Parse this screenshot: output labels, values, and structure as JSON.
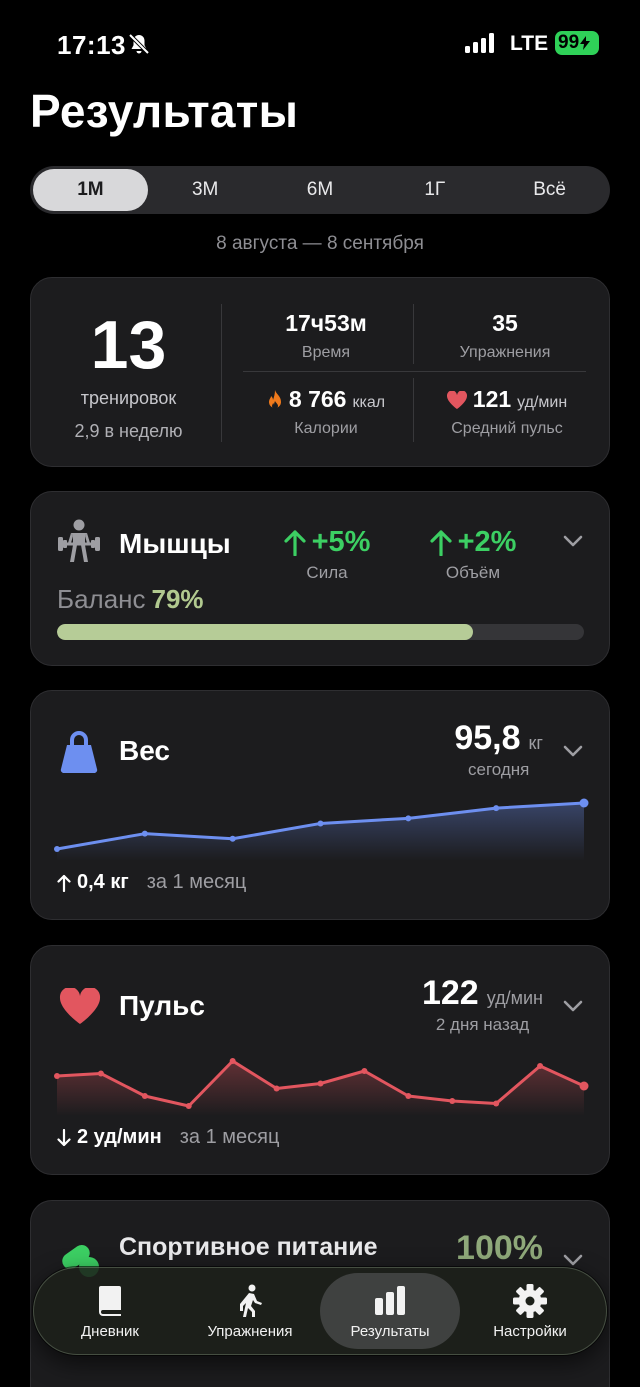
{
  "status_bar": {
    "time": "17:13",
    "network": "LTE",
    "battery": "99"
  },
  "title": "Результаты",
  "periods": [
    "1М",
    "3М",
    "6М",
    "1Г",
    "Всё"
  ],
  "selected_period": "1М",
  "date_range": "8 августа — 8 сентября",
  "summary": {
    "workouts": "13",
    "workouts_label": "тренировок",
    "per_week": "2,9 в неделю",
    "time_value": "17ч53м",
    "time_label": "Время",
    "exercises_value": "35",
    "exercises_label": "Упражнения",
    "calories_value": "8 766",
    "calories_unit": "ккал",
    "calories_label": "Калории",
    "pulse_value": "121",
    "pulse_unit": "уд/мин",
    "pulse_label": "Средний пульс"
  },
  "muscles": {
    "title": "Мышцы",
    "strength_value": "+5%",
    "strength_label": "Сила",
    "volume_value": "+2%",
    "volume_label": "Объём",
    "balance_label": "Баланс",
    "balance_value": "79%",
    "balance_fraction": 0.79
  },
  "weight": {
    "title": "Вес",
    "value": "95,8",
    "unit": "кг",
    "subtitle": "сегодня",
    "change": "0,4 кг",
    "change_direction": "up",
    "period": "за 1 месяц",
    "series": [
      94.9,
      95.2,
      95.1,
      95.4,
      95.5,
      95.7,
      95.8
    ],
    "series_alt": null
  },
  "pulse": {
    "title": "Пульс",
    "value": "122",
    "unit": "уд/мин",
    "subtitle": "2 дня назад",
    "change": "2 уд/мин",
    "change_direction": "down",
    "period": "за 1 месяц",
    "series": [
      124,
      124.5,
      120,
      118,
      127,
      121.5,
      122.5,
      125,
      120,
      119,
      118.5,
      126,
      122
    ]
  },
  "nutrition": {
    "title": "Спортивное питание",
    "value": "100%"
  },
  "tabs": [
    {
      "label": "Дневник",
      "icon": "book-icon"
    },
    {
      "label": "Упражнения",
      "icon": "walking-person-icon"
    },
    {
      "label": "Результаты",
      "icon": "bar-chart-icon"
    },
    {
      "label": "Настройки",
      "icon": "gear-icon"
    }
  ],
  "active_tab": "Результаты",
  "colors": {
    "accent_green": "#3ccf63",
    "balance": "#b6cc97",
    "weight_line": "#6d8ff0",
    "pulse_line": "#e2565f",
    "battery": "#2fd158"
  }
}
